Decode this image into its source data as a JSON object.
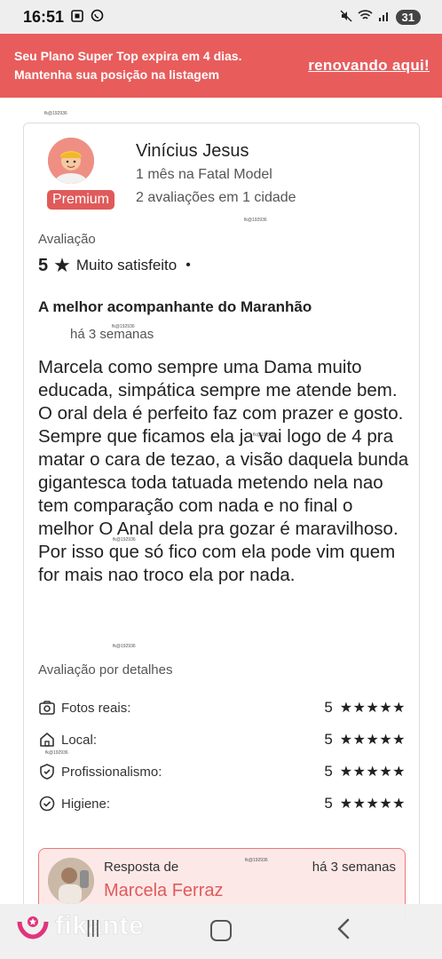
{
  "status_bar": {
    "time": "16:51",
    "left_icons": [
      "screenshot-icon",
      "whatsapp-icon"
    ],
    "right_icons": [
      "mute-icon",
      "wifi-icon",
      "signal-icon"
    ],
    "battery": "31"
  },
  "promo_banner": {
    "line1": "Seu Plano Super Top expira em 4 dias.",
    "line2": "Mantenha sua posição na listagem",
    "link": "renovando aqui!"
  },
  "watermark": "fk@192936",
  "reviewer": {
    "name": "Vinícius Jesus",
    "since": "1 mês na Fatal Model",
    "stats": "2 avaliações em 1 cidade",
    "badge": "Premium"
  },
  "rating": {
    "label": "Avaliação",
    "score": "5",
    "star": "★",
    "text": "Muito satisfeito",
    "separator": "•"
  },
  "review": {
    "title": "A melhor acompanhante do Maranhão",
    "date": "há 3 semanas",
    "body": "Marcela como sempre uma Dama muito educada, simpática sempre me atende bem. O oral dela é perfeito faz com prazer e gosto. Sempre que ficamos ela ja vai logo de 4 pra matar o cara de tezao, a visão daquela bunda gigantesca toda tatuada metendo nela nao tem comparação com nada e no final o melhor O Anal dela pra gozar é maravilhoso. Por isso que só fico com ela pode vim quem for mais nao troco ela por nada."
  },
  "details": {
    "label": "Avaliação por detalhes",
    "items": [
      {
        "icon": "camera-check-icon",
        "label": "Fotos reais:",
        "score": "5",
        "stars": "★★★★★"
      },
      {
        "icon": "home-icon",
        "label": "Local:",
        "score": "5",
        "stars": "★★★★★"
      },
      {
        "icon": "shield-check-icon",
        "label": "Profissionalismo:",
        "score": "5",
        "stars": "★★★★★"
      },
      {
        "icon": "check-circle-icon",
        "label": "Higiene:",
        "score": "5",
        "stars": "★★★★★"
      }
    ]
  },
  "reply": {
    "label": "Resposta de",
    "name": "Marcela Ferraz",
    "date": "há 3 semanas"
  },
  "nav": {
    "brand": "fikante",
    "recents": "|||",
    "home_icon": "home-square-icon",
    "back_icon": "back-chevron-icon"
  },
  "colors": {
    "accent": "#e85c5c",
    "reply_bg": "#fde8e8",
    "badge": "#e05a5a"
  }
}
